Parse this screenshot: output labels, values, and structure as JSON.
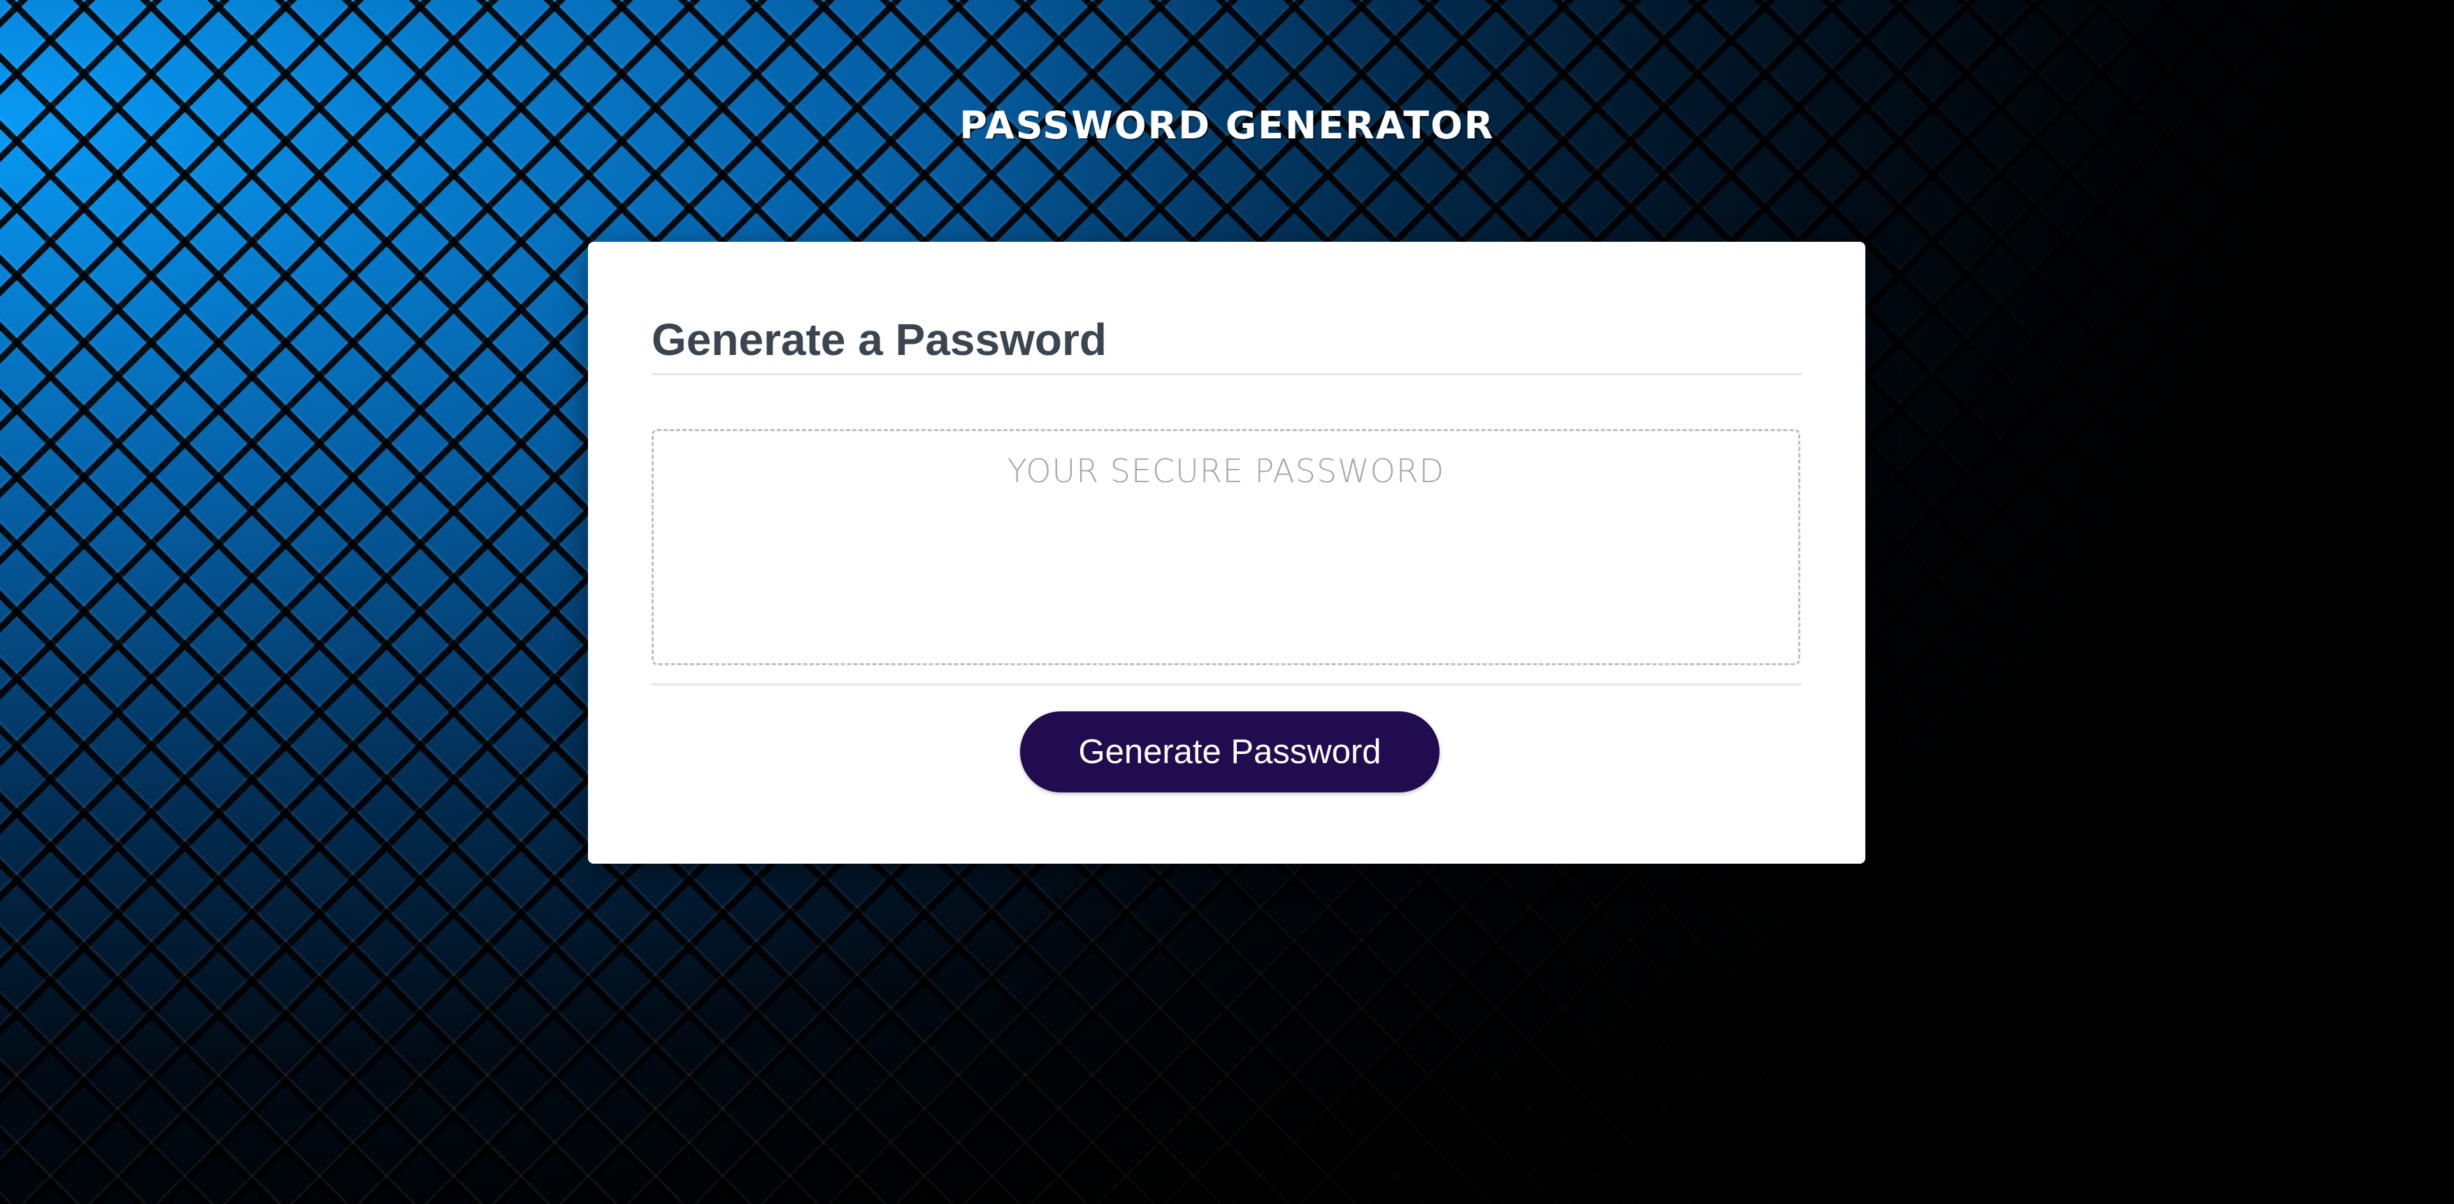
{
  "app": {
    "title": "Password Generator"
  },
  "card": {
    "title": "Generate a Password",
    "password_placeholder": "Your Secure Password",
    "password_value": "",
    "generate_button_label": "Generate Password"
  },
  "colors": {
    "button_background": "#200c4e",
    "title_text": "#3a4550",
    "background_accent": "#0a9cff"
  }
}
